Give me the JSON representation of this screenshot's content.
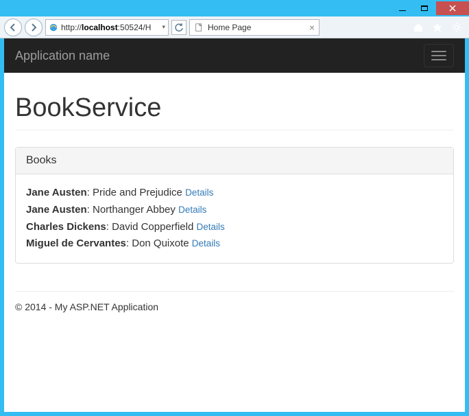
{
  "window": {
    "url_prefix": "http://",
    "url_host": "localhost",
    "url_suffix": ":50524/H",
    "tab_title": "Home Page"
  },
  "navbar": {
    "brand": "Application name"
  },
  "page": {
    "title": "BookService"
  },
  "panel": {
    "heading": "Books",
    "details_label": "Details",
    "books": [
      {
        "author": "Jane Austen",
        "title": "Pride and Prejudice"
      },
      {
        "author": "Jane Austen",
        "title": "Northanger Abbey"
      },
      {
        "author": "Charles Dickens",
        "title": "David Copperfield"
      },
      {
        "author": "Miguel de Cervantes",
        "title": "Don Quixote"
      }
    ]
  },
  "footer": {
    "text": "© 2014 - My ASP.NET Application"
  }
}
